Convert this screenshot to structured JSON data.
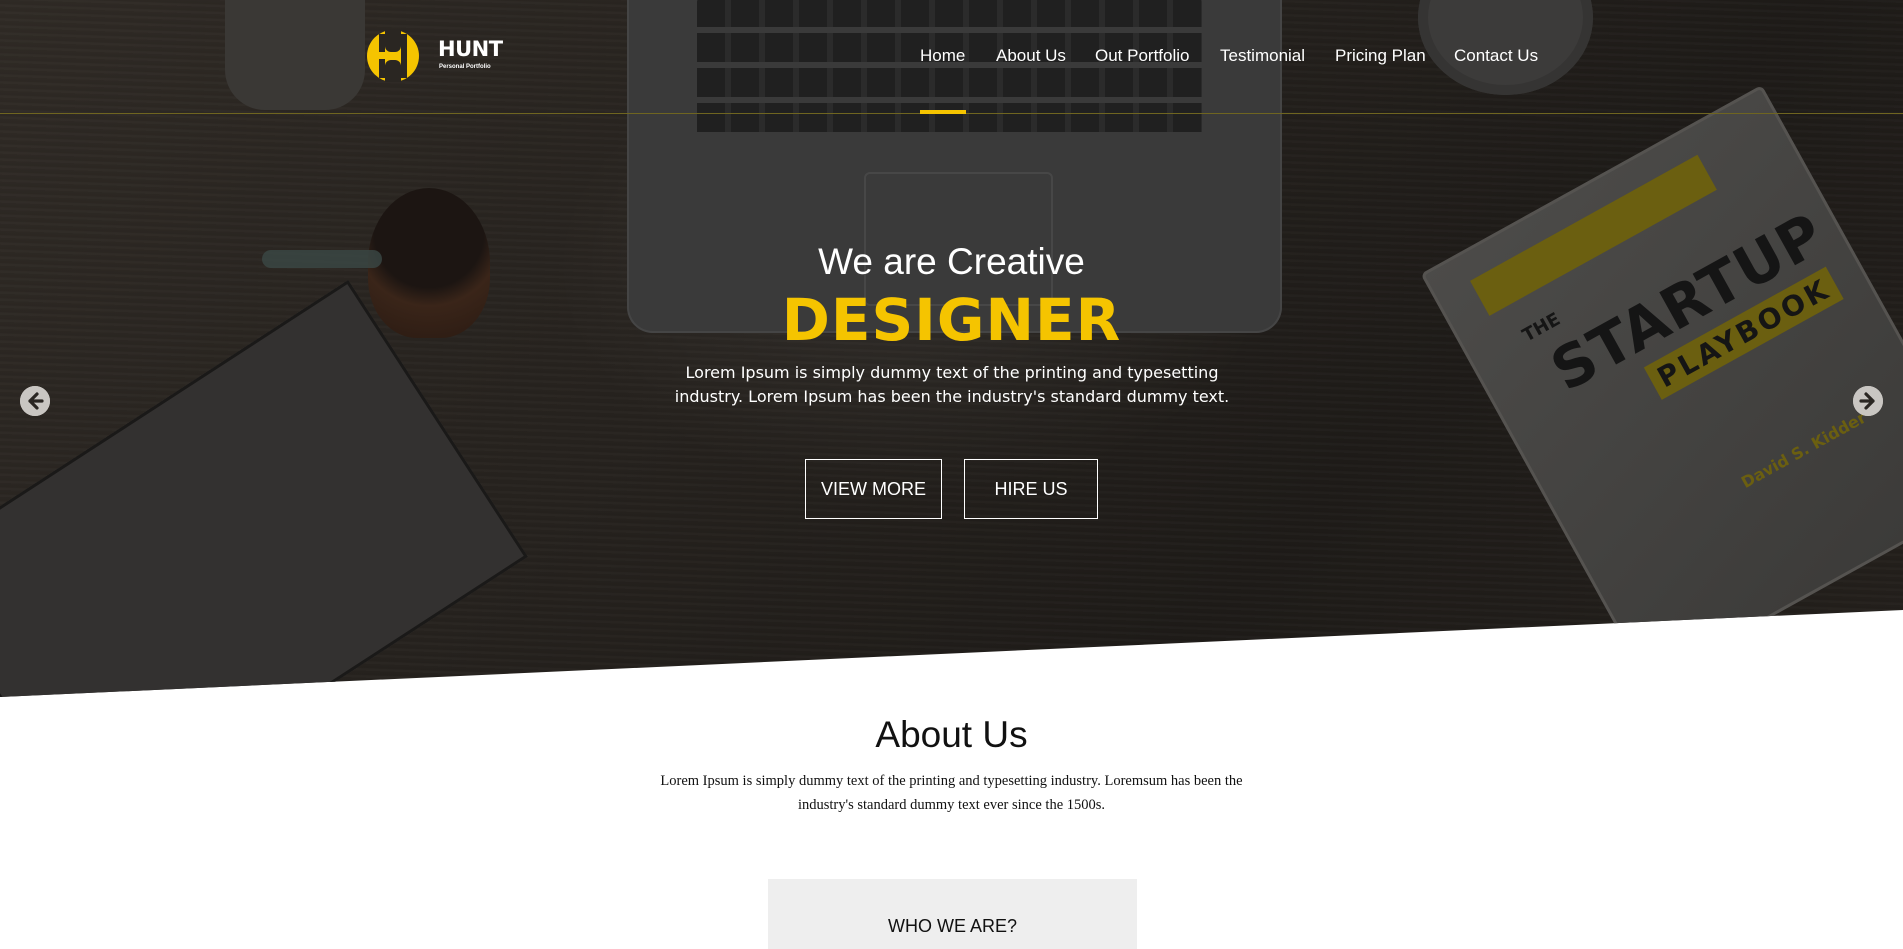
{
  "brand": {
    "name": "HUNT",
    "tagline": "Personal Portfolio",
    "accent_color": "#f5c400"
  },
  "nav": {
    "items": [
      {
        "label": "Home",
        "active": true
      },
      {
        "label": "About Us",
        "active": false
      },
      {
        "label": "Out Portfolio",
        "active": false
      },
      {
        "label": "Testimonial",
        "active": false
      },
      {
        "label": "Pricing Plan",
        "active": false
      },
      {
        "label": "Contact Us",
        "active": false
      }
    ]
  },
  "hero": {
    "kicker": "We are Creative",
    "title": "DESIGNER",
    "description": "Lorem Ipsum is simply dummy text of the printing and typesetting industry. Lorem Ipsum has been the industry's standard dummy text.",
    "buttons": {
      "view_more": "VIEW MORE",
      "hire_us": "HIRE US"
    },
    "prev_icon": "arrow-left-circle-icon",
    "next_icon": "arrow-right-circle-icon",
    "background_book": {
      "the": "THE",
      "title": "STARTUP",
      "subtitle": "PLAYBOOK",
      "author": "David S. Kidder"
    }
  },
  "about": {
    "title": "About Us",
    "description": "Lorem Ipsum is simply dummy text of the printing and typesetting industry. Loremsum has been the industry's standard dummy text ever since the 1500s.",
    "who_we_are": "WHO WE ARE?"
  }
}
